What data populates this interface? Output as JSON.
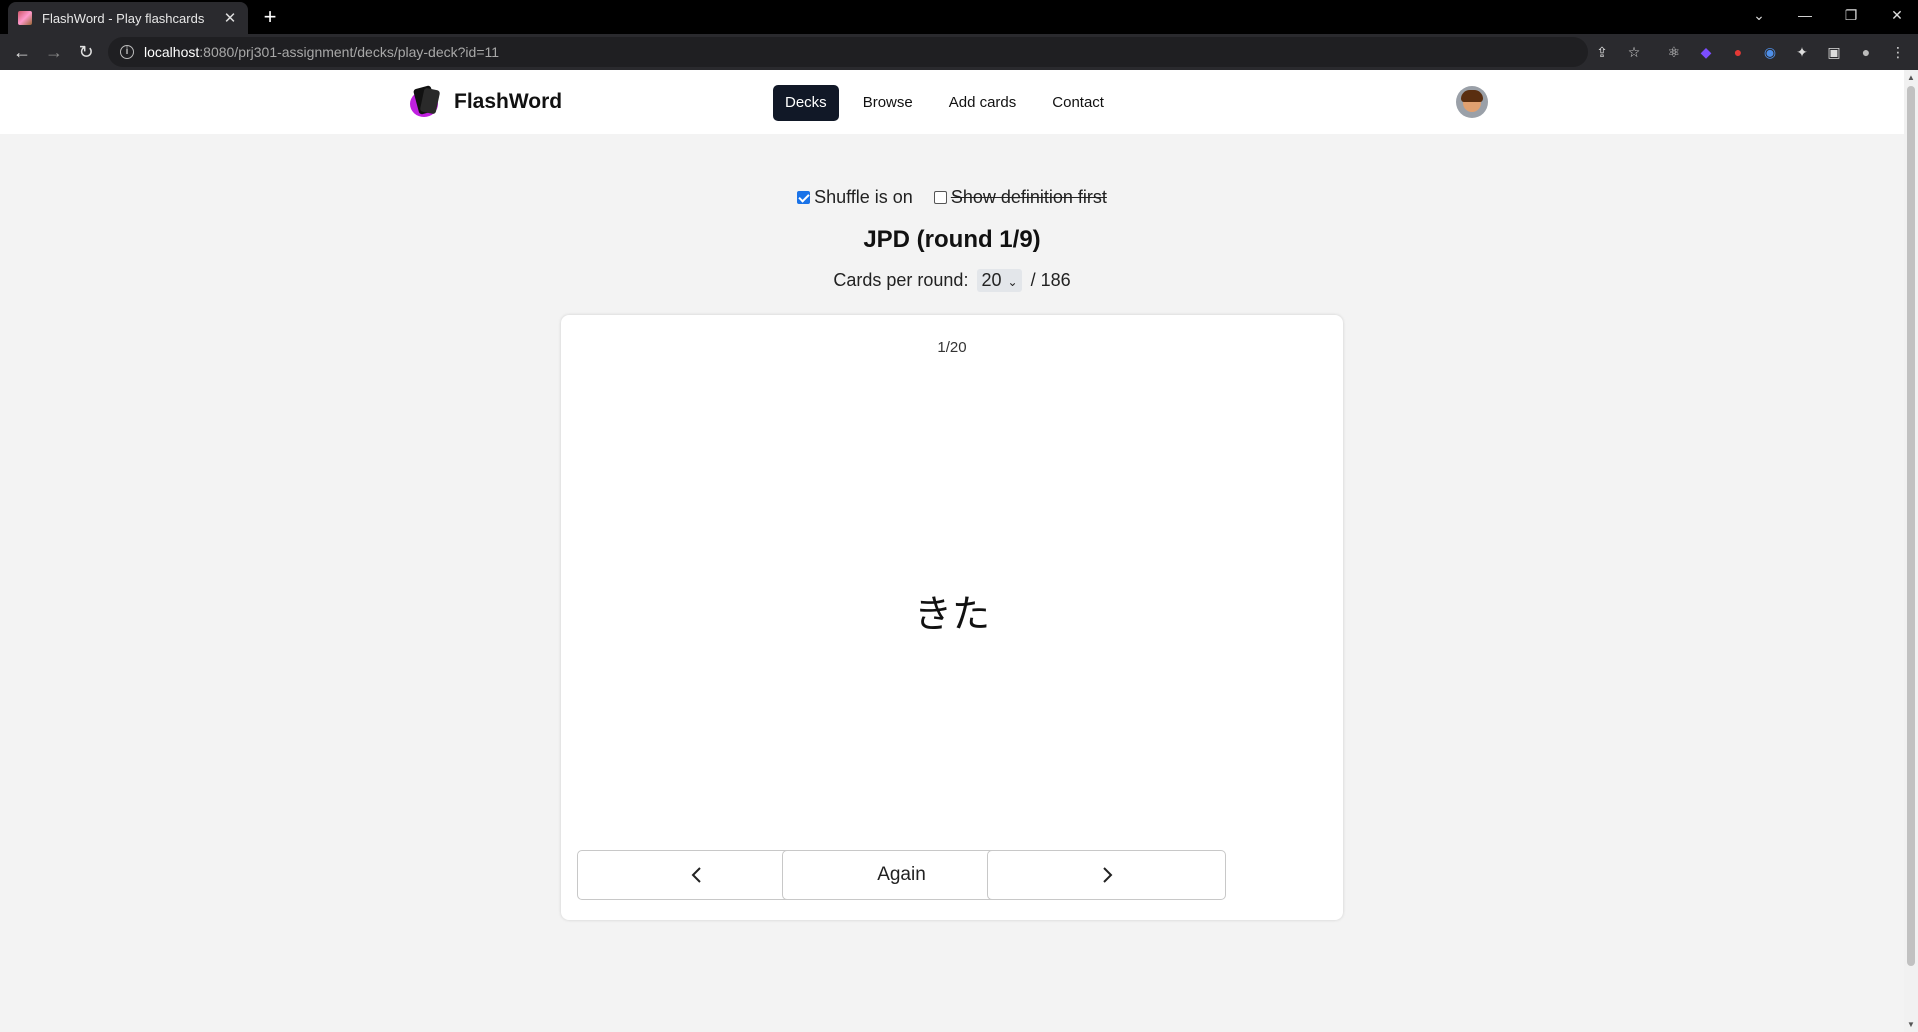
{
  "browser": {
    "tab_title": "FlashWord - Play flashcards",
    "url_host": "localhost",
    "url_path": ":8080/prj301-assignment/decks/play-deck?id=11"
  },
  "header": {
    "brand": "FlashWord",
    "nav": [
      "Decks",
      "Browse",
      "Add cards",
      "Contact"
    ],
    "active_nav": "Decks"
  },
  "options": {
    "shuffle_label": "Shuffle is on",
    "shuffle_checked": true,
    "definition_first_label": "Show definition first",
    "definition_first_checked": false
  },
  "deck": {
    "title": "JPD (round 1/9)",
    "per_round_label": "Cards per round:",
    "per_round_value": "20",
    "total": "/ 186"
  },
  "card": {
    "counter": "1/20",
    "term": "きた"
  },
  "buttons": {
    "prev": "‹",
    "again": "Again",
    "next": "›"
  },
  "colors": {
    "active_nav_bg": "#111827",
    "checkbox_accent": "#1a73e8",
    "brand_logo": "#c020e0"
  }
}
